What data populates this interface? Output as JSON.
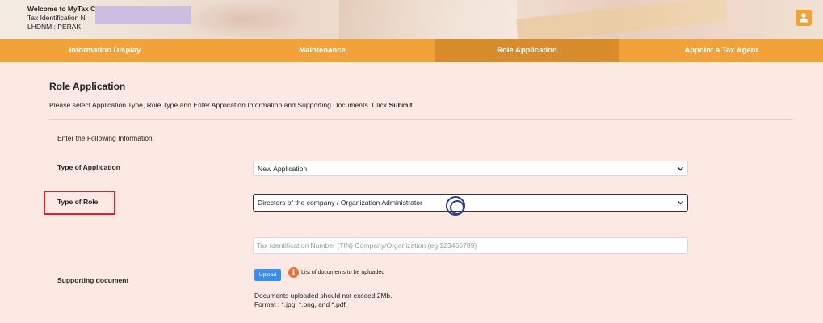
{
  "header": {
    "welcome": "Welcome to MyTax C",
    "tin_label": "Tax Identification N",
    "branch": "LHDNM : PERAK",
    "user_icon": "user-icon"
  },
  "nav": {
    "tabs": [
      {
        "label": "Information Display",
        "active": false
      },
      {
        "label": "Maintenance",
        "active": false
      },
      {
        "label": "Role Application",
        "active": true
      },
      {
        "label": "Appoint a Tax Agent",
        "active": false
      }
    ]
  },
  "page": {
    "title": "Role Application",
    "instruction": "Please select Application Type, Role Type and Enter Application Information and Supporting Documents. Click ",
    "instruction_bold": "Submit",
    "instruction_end": ".",
    "section_label": "Enter the Following Information."
  },
  "form": {
    "type_of_application": {
      "label": "Type of Application",
      "value": "New Application"
    },
    "type_of_role": {
      "label": "Type of Role",
      "value": "Directors of the company / Organization Administrator"
    },
    "tin": {
      "placeholder": "Tax Identification Number (TIN) Company/Organization (eg:123456789)"
    },
    "supporting_document": {
      "label": "Supporting document",
      "upload_label": "Upload",
      "info_icon": "info-icon",
      "list_link": "List of documents to be uploaded",
      "note_line1": "Documents uploaded should not exceed 2Mb.",
      "note_line2": "Format : *.jpg, *.png, and *.pdf."
    }
  },
  "colors": {
    "accent": "#f2a23a",
    "accent_active": "#d98c2e",
    "background": "#fde9e4",
    "highlight_box": "#e0222a",
    "upload_button": "#3a8ef0"
  }
}
